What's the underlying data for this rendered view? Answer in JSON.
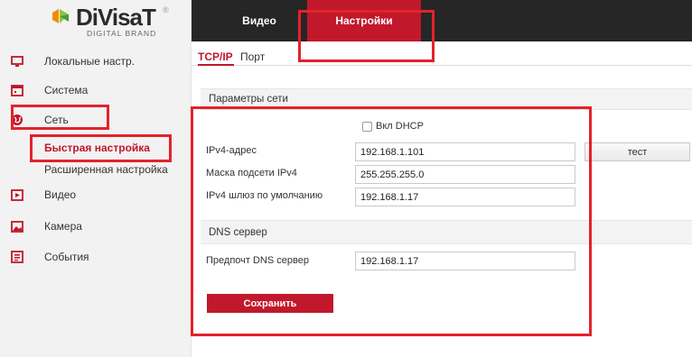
{
  "logo": {
    "brand": "DiVisaT",
    "reg": "®",
    "tagline": "DIGITAL BRAND"
  },
  "sidebar": {
    "items": [
      {
        "label": "Локальные настр.",
        "icon": "monitor-icon"
      },
      {
        "label": "Система",
        "icon": "system-icon"
      },
      {
        "label": "Сеть",
        "icon": "network-globe-icon"
      },
      {
        "label": "Видео",
        "icon": "video-icon"
      },
      {
        "label": "Камера",
        "icon": "image-icon"
      },
      {
        "label": "События",
        "icon": "events-icon"
      }
    ],
    "subitems": [
      {
        "label": "Быстрая настройка",
        "active": true
      },
      {
        "label": "Расширенная настройка",
        "active": false
      }
    ]
  },
  "topnav": {
    "video": "Видео",
    "settings": "Настройки"
  },
  "tabs": {
    "tcpip": "TCP/IP",
    "port": "Порт"
  },
  "network": {
    "section_title": "Параметры сети",
    "dhcp_label": "Вкл DHCP",
    "dhcp_checked": false,
    "ipv4_label": "IPv4-адрес",
    "ipv4_value": "192.168.1.101",
    "mask_label": "Маска подсети IPv4",
    "mask_value": "255.255.255.0",
    "gateway_label": "IPv4 шлюз по умолчанию",
    "gateway_value": "192.168.1.17",
    "test_label": "тест"
  },
  "dns": {
    "section_title": "DNS сервер",
    "pref_label": "Предпочт DNS сервер",
    "pref_value": "192.168.1.17"
  },
  "actions": {
    "save_label": "Сохранить"
  },
  "colors": {
    "accent": "#c2182c",
    "topbar": "#262626",
    "sidebar_bg": "#f2f2f2",
    "highlight": "#e3222b",
    "nav_icon": "#c0172b"
  }
}
